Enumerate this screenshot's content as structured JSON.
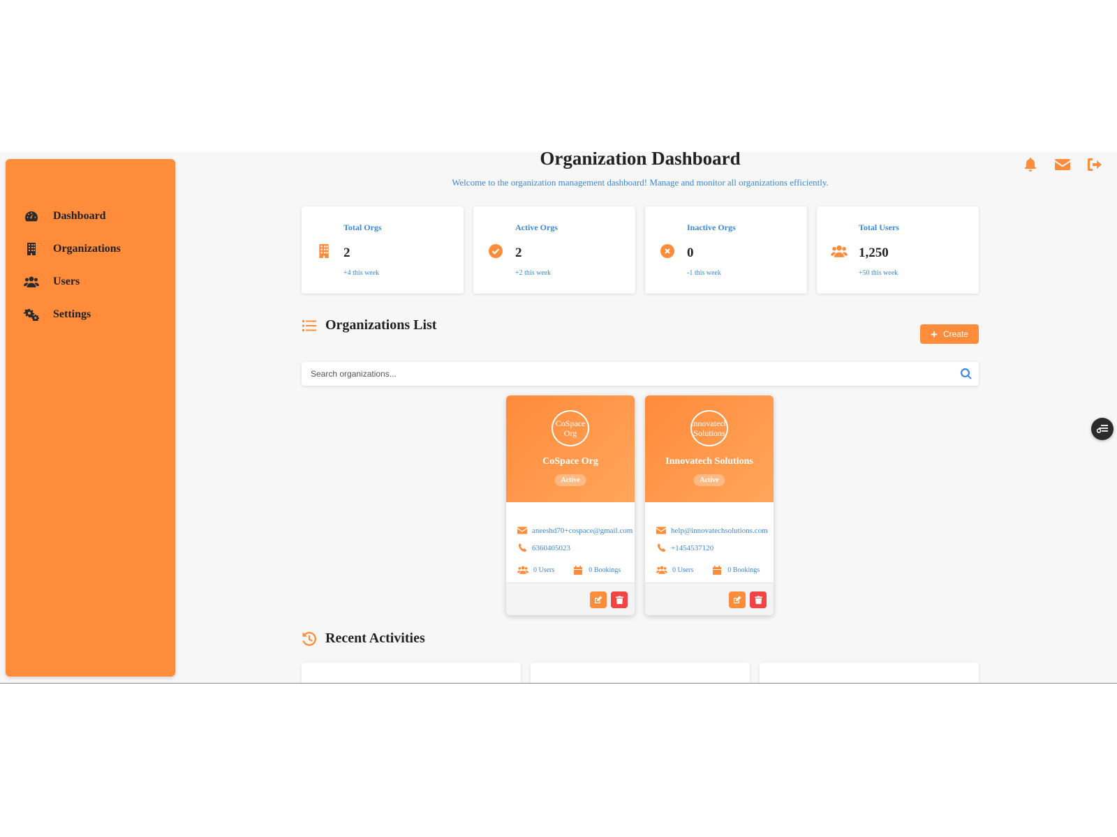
{
  "sidebar": {
    "items": [
      {
        "label": "Dashboard",
        "icon": "gauge-icon"
      },
      {
        "label": "Organizations",
        "icon": "building-icon"
      },
      {
        "label": "Users",
        "icon": "users-icon"
      },
      {
        "label": "Settings",
        "icon": "gears-icon"
      }
    ]
  },
  "header": {
    "title": "Organization Dashboard",
    "subtitle": "Welcome to the organization management dashboard! Manage and monitor all organizations efficiently."
  },
  "stats": [
    {
      "label": "Total Orgs",
      "value": "2",
      "trend": "+4 this week",
      "icon": "building-icon"
    },
    {
      "label": "Active Orgs",
      "value": "2",
      "trend": "+2 this week",
      "icon": "check-circle-icon"
    },
    {
      "label": "Inactive Orgs",
      "value": "0",
      "trend": "-1 this week",
      "icon": "x-circle-icon"
    },
    {
      "label": "Total Users",
      "value": "1,250",
      "trend": "+50 this week",
      "icon": "users-icon"
    }
  ],
  "orgs_section": {
    "title": "Organizations List",
    "create_label": "Create",
    "search_placeholder": "Search organizations..."
  },
  "orgs": [
    {
      "logo_alt": "CoSpace Org",
      "name": "CoSpace Org",
      "status": "Active",
      "email": "aneeshd70+cospace@gmail.com",
      "phone": "6360405023",
      "users": "0 Users",
      "bookings": "0 Bookings"
    },
    {
      "logo_alt": "Innovatech Solutions",
      "name": "Innovatech Solutions",
      "status": "Active",
      "email": "help@innovatechsolutions.com",
      "phone": "+1454537120",
      "users": "0 Users",
      "bookings": "0 Bookings"
    }
  ],
  "activities_section": {
    "title": "Recent Activities"
  },
  "colors": {
    "accent": "#ff8c3a",
    "link": "#3b87d9",
    "danger": "#f24444"
  }
}
